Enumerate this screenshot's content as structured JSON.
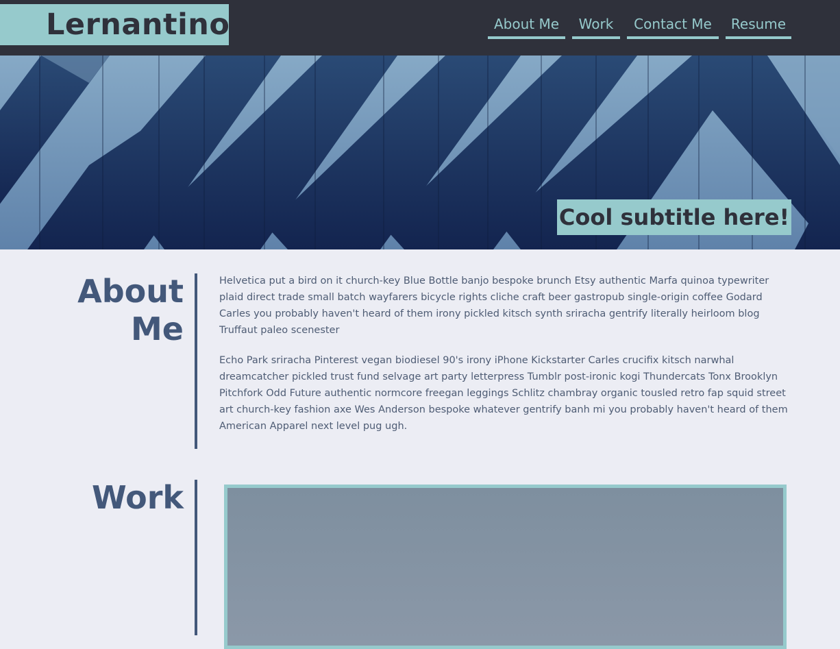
{
  "site": {
    "logo": "Lernantino",
    "nav": [
      {
        "label": "About Me"
      },
      {
        "label": "Work"
      },
      {
        "label": "Contact Me"
      },
      {
        "label": "Resume"
      }
    ]
  },
  "hero": {
    "subtitle": "Cool subtitle here!"
  },
  "about": {
    "title_line1": "About",
    "title_line2": "Me",
    "paragraphs": [
      "Helvetica put a bird on it church-key Blue Bottle banjo bespoke brunch Etsy authentic Marfa quinoa typewriter plaid direct trade small batch wayfarers bicycle rights cliche craft beer gastropub single-origin coffee Godard Carles you probably haven't heard of them irony pickled kitsch synth sriracha gentrify literally heirloom blog Truffaut paleo scenester",
      "Echo Park sriracha Pinterest vegan biodiesel 90's irony iPhone Kickstarter Carles crucifix kitsch narwhal dreamcatcher pickled trust fund selvage art party letterpress Tumblr post-ironic kogi Thundercats Tonx Brooklyn Pitchfork Odd Future authentic normcore freegan leggings Schlitz chambray organic tousled retro fap squid street art church-key fashion axe Wes Anderson bespoke whatever gentrify banh mi you probably haven't heard of them American Apparel next level pug ugh."
    ]
  },
  "work": {
    "title": "Work"
  },
  "colors": {
    "header_bg": "#2f313b",
    "accent": "#96cacc",
    "page_bg": "#ecedf4",
    "heading": "#43587a",
    "body_text": "#4e5c74"
  }
}
